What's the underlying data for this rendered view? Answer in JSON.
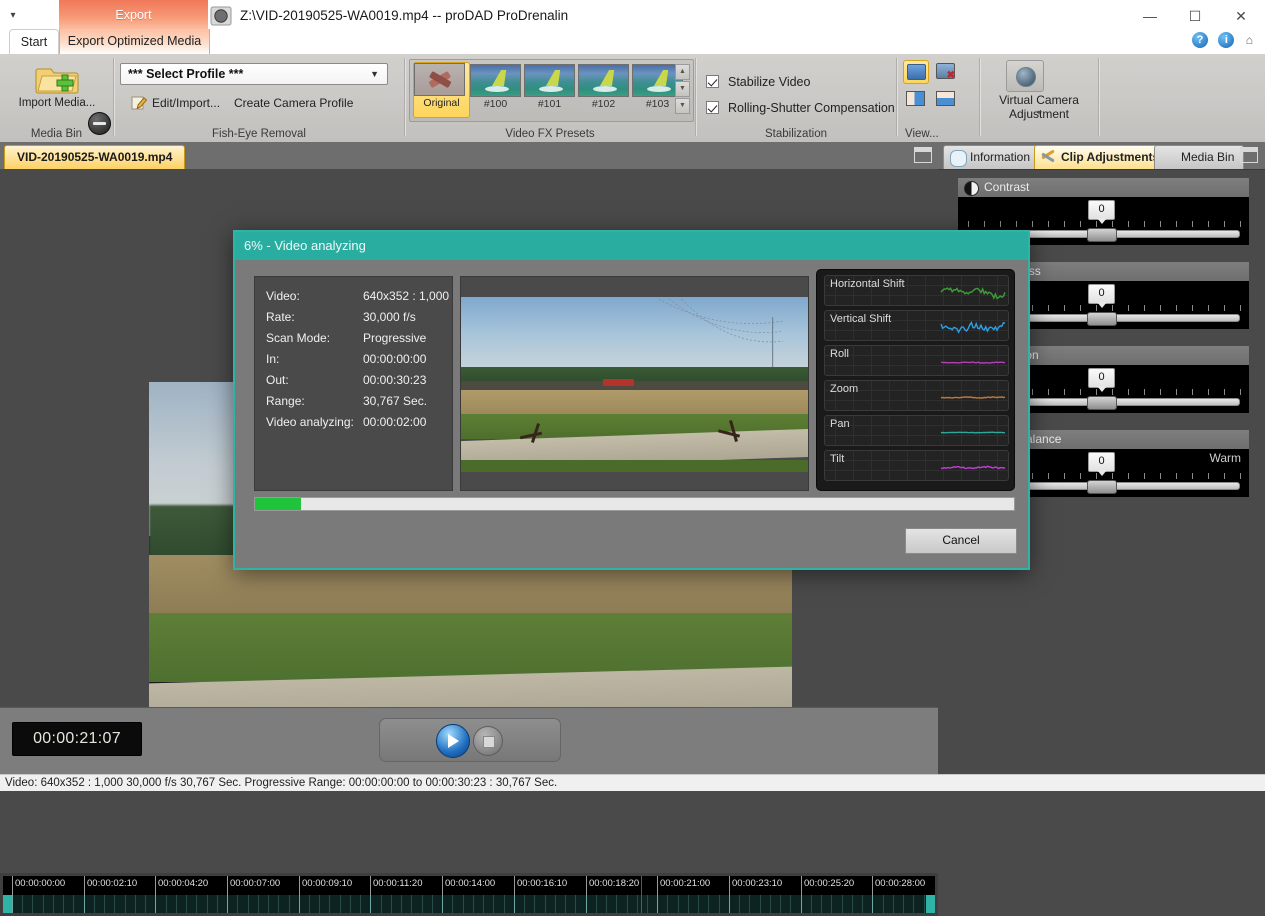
{
  "window": {
    "doc_title": "Z:\\VID-20190525-WA0019.mp4 -- proDAD ProDrenalin",
    "minimize": "—",
    "maximize": "☐",
    "close": "✕",
    "qat_caret": "▾",
    "help_label": "?",
    "info_label": "i",
    "home_label": "⌂"
  },
  "ribbon": {
    "tab_export_top": "Export",
    "tabs": [
      {
        "label": "Start",
        "active": true
      },
      {
        "label": "Export Optimized Media",
        "active": false
      }
    ],
    "groups": {
      "media_bin": {
        "title": "Media Bin",
        "import_label": "Import Media...",
        "minus_icon": "minus-circle-icon"
      },
      "fish_eye": {
        "title": "Fish-Eye Removal",
        "profile_value": "*** Select Profile ***",
        "profile_caret": "▼",
        "edit_import": "Edit/Import...",
        "create_camera_profile": "Create Camera Profile"
      },
      "video_fx": {
        "title": "Video FX Presets",
        "presets": [
          {
            "caption": "Original",
            "selected": true
          },
          {
            "caption": "#100",
            "selected": false
          },
          {
            "caption": "#101",
            "selected": false
          },
          {
            "caption": "#102",
            "selected": false
          },
          {
            "caption": "#103",
            "selected": false
          }
        ],
        "scroll_up": "▲",
        "scroll_mid": "▼",
        "scroll_down": "▼"
      },
      "stabilization": {
        "title": "Stabilization",
        "checkboxes": [
          {
            "label": "Stabilize Video",
            "checked": true
          },
          {
            "label": "Rolling-Shutter Compensation",
            "checked": true
          }
        ]
      },
      "view": {
        "title": "View..."
      },
      "virtual_camera": {
        "label": "Virtual Camera Adjustment",
        "caret": "▾"
      }
    }
  },
  "workspace": {
    "doc_tab": "VID-20190525-WA0019.mp4",
    "maximize_icon": "restore-icon",
    "timecode": "00:00:21:07",
    "play_icon": "play-icon",
    "stop_icon": "stop-icon",
    "ruler_labels": [
      "00:00:00:00",
      "00:00:02:10",
      "00:00:04:20",
      "00:00:07:00",
      "00:00:09:10",
      "00:00:11:20",
      "00:00:14:00",
      "00:00:16:10",
      "00:00:18:20",
      "00:00:21:00",
      "00:00:23:10",
      "00:00:25:20",
      "00:00:28:00"
    ],
    "playhead_position_pct": 68.5
  },
  "status_bar": {
    "text": "Video: 640x352 : 1,000  30,000 f/s  30,767 Sec.  Progressive  Range: 00:00:00:00 to 00:00:30:23 : 30,767 Sec."
  },
  "right_panel": {
    "tabs": [
      {
        "label": "Information",
        "icon": "speech-bubble-icon",
        "active": false
      },
      {
        "label": "Clip Adjustments",
        "icon": "tools-icon",
        "active": true
      },
      {
        "label": "Media Bin",
        "icon": "red-square-icon",
        "active": false
      }
    ],
    "maximize_icon": "restore-icon",
    "adjustments": [
      {
        "name": "Contrast",
        "value": "0",
        "right_label": ""
      },
      {
        "name": "Brightness",
        "value": "0",
        "right_label": ""
      },
      {
        "name": "Saturation",
        "value": "0",
        "right_label": ""
      },
      {
        "name": "White Balance",
        "value": "0",
        "right_label": "Warm"
      }
    ]
  },
  "dialog": {
    "title": "6% - Video analyzing",
    "progress_percent": 6,
    "cancel_label": "Cancel",
    "info_rows": [
      {
        "key": "Video:",
        "value": "640x352 : 1,000"
      },
      {
        "key": "Rate:",
        "value": "30,000 f/s"
      },
      {
        "key": "Scan Mode:",
        "value": "Progressive"
      },
      {
        "key": "In:",
        "value": "00:00:00:00"
      },
      {
        "key": "Out:",
        "value": "00:00:30:23"
      },
      {
        "key": "Range:",
        "value": "30,767 Sec."
      },
      {
        "key": "Video analyzing:",
        "value": "00:00:02:00"
      }
    ],
    "graphs": [
      {
        "label": "Horizontal Shift",
        "color": "#3f9e3a"
      },
      {
        "label": "Vertical Shift",
        "color": "#2f9fe0"
      },
      {
        "label": "Roll",
        "color": "#b43fb4"
      },
      {
        "label": "Zoom",
        "color": "#c07a3a"
      },
      {
        "label": "Pan",
        "color": "#2fa89a"
      },
      {
        "label": "Tilt",
        "color": "#c23fd8"
      }
    ]
  },
  "colors": {
    "dialog_accent": "#2aada1",
    "progress_green": "#1fc43c",
    "tab_active": "#fde08d",
    "ribbon_export": "#f0785a"
  }
}
